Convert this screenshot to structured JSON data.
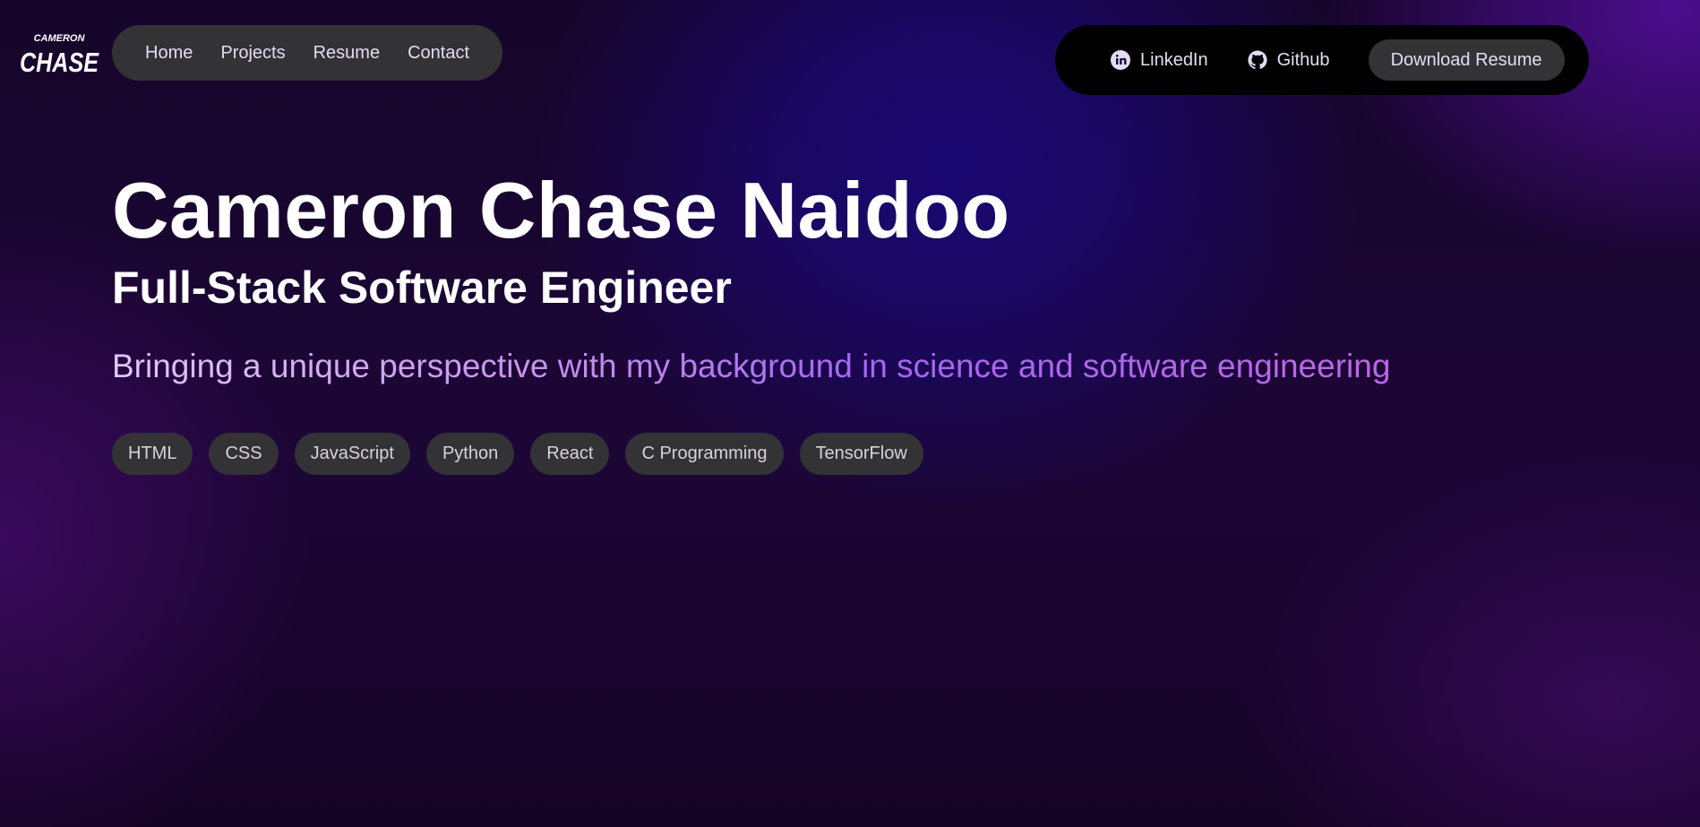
{
  "logo": {
    "top_text": "CAMERON",
    "main_text": "CHASE"
  },
  "nav": {
    "items": [
      {
        "label": "Home"
      },
      {
        "label": "Projects"
      },
      {
        "label": "Resume"
      },
      {
        "label": "Contact"
      }
    ]
  },
  "actions": {
    "linkedin_label": "LinkedIn",
    "linkedin_icon": "linkedin-icon",
    "github_label": "Github",
    "github_icon": "github-icon",
    "download_label": "Download Resume"
  },
  "hero": {
    "name": "Cameron Chase Naidoo",
    "role": "Full-Stack Software Engineer",
    "tagline": "Bringing a unique perspective with my background in science and software engineering"
  },
  "skills": [
    "HTML",
    "CSS",
    "JavaScript",
    "Python",
    "React",
    "C Programming",
    "TensorFlow"
  ],
  "colors": {
    "pill_bg": "#333235",
    "action_bg": "#000000",
    "text_light": "#e4dcf2",
    "accent_purple": "#a466f0"
  }
}
